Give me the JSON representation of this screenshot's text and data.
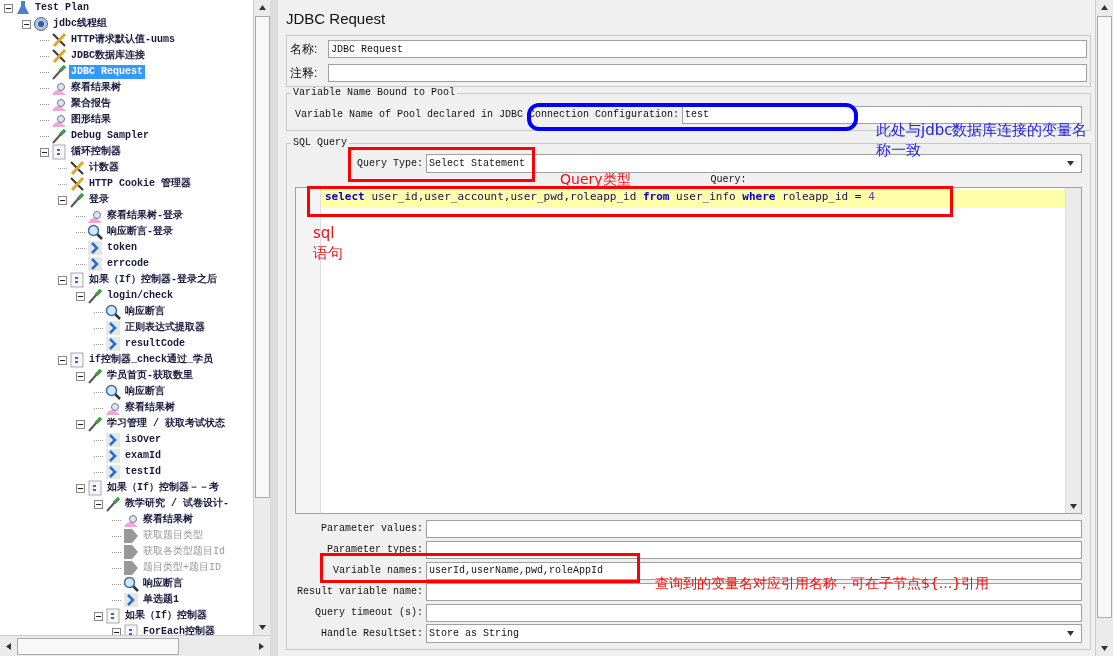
{
  "tree": [
    {
      "label": "Test Plan",
      "kind": "testplan",
      "expanded": true,
      "selected": false,
      "disabled": false,
      "children": [
        {
          "label": "jdbc线程组",
          "kind": "threadgroup",
          "expanded": true,
          "selected": false,
          "disabled": false,
          "children": [
            {
              "label": "HTTP请求默认值-uums",
              "kind": "config",
              "selected": false,
              "disabled": false
            },
            {
              "label": "JDBC数据库连接",
              "kind": "config",
              "selected": false,
              "disabled": false
            },
            {
              "label": "JDBC Request",
              "kind": "sampler",
              "selected": true,
              "disabled": false
            },
            {
              "label": "察看结果树",
              "kind": "listener",
              "selected": false,
              "disabled": false
            },
            {
              "label": "聚合报告",
              "kind": "listener",
              "selected": false,
              "disabled": false
            },
            {
              "label": "图形结果",
              "kind": "listener",
              "selected": false,
              "disabled": false
            },
            {
              "label": "Debug Sampler",
              "kind": "sampler",
              "selected": false,
              "disabled": false
            },
            {
              "label": "循环控制器",
              "kind": "controller",
              "expanded": true,
              "selected": false,
              "disabled": false,
              "children": [
                {
                  "label": "计数器",
                  "kind": "config",
                  "selected": false,
                  "disabled": false
                },
                {
                  "label": "HTTP Cookie 管理器",
                  "kind": "config",
                  "selected": false,
                  "disabled": false
                },
                {
                  "label": "登录",
                  "kind": "sampler",
                  "expanded": true,
                  "selected": false,
                  "disabled": false,
                  "children": [
                    {
                      "label": "察看结果树-登录",
                      "kind": "listener",
                      "selected": false,
                      "disabled": false
                    },
                    {
                      "label": "响应断言-登录",
                      "kind": "assertion",
                      "selected": false,
                      "disabled": false
                    },
                    {
                      "label": "token",
                      "kind": "extractor",
                      "selected": false,
                      "disabled": false
                    },
                    {
                      "label": "errcode",
                      "kind": "extractor",
                      "selected": false,
                      "disabled": false
                    }
                  ]
                },
                {
                  "label": "如果（If）控制器-登录之后",
                  "kind": "controller",
                  "expanded": true,
                  "selected": false,
                  "disabled": false,
                  "children": [
                    {
                      "label": "login/check",
                      "kind": "sampler",
                      "expanded": true,
                      "selected": false,
                      "disabled": false,
                      "children": [
                        {
                          "label": "响应断言",
                          "kind": "assertion",
                          "selected": false,
                          "disabled": false
                        },
                        {
                          "label": "正则表达式提取器",
                          "kind": "extractor",
                          "selected": false,
                          "disabled": false
                        },
                        {
                          "label": "resultCode",
                          "kind": "extractor",
                          "selected": false,
                          "disabled": false
                        }
                      ]
                    }
                  ]
                },
                {
                  "label": "if控制器_check通过_学员",
                  "kind": "controller",
                  "expanded": true,
                  "selected": false,
                  "disabled": false,
                  "children": [
                    {
                      "label": "学员首页-获取数里",
                      "kind": "sampler",
                      "expanded": true,
                      "selected": false,
                      "disabled": false,
                      "children": [
                        {
                          "label": "响应断言",
                          "kind": "assertion",
                          "selected": false,
                          "disabled": false
                        },
                        {
                          "label": "察看结果树",
                          "kind": "listener",
                          "selected": false,
                          "disabled": false
                        }
                      ]
                    },
                    {
                      "label": "学习管理 / 获取考试状态",
                      "kind": "sampler",
                      "expanded": true,
                      "selected": false,
                      "disabled": false,
                      "children": [
                        {
                          "label": "isOver",
                          "kind": "extractor",
                          "selected": false,
                          "disabled": false
                        },
                        {
                          "label": "examId",
                          "kind": "extractor",
                          "selected": false,
                          "disabled": false
                        },
                        {
                          "label": "testId",
                          "kind": "extractor",
                          "selected": false,
                          "disabled": false
                        }
                      ]
                    },
                    {
                      "label": "如果（If）控制器－－考",
                      "kind": "controller",
                      "expanded": true,
                      "selected": false,
                      "disabled": false,
                      "children": [
                        {
                          "label": "教学研究 / 试卷设计-",
                          "kind": "sampler",
                          "expanded": true,
                          "selected": false,
                          "disabled": false,
                          "children": [
                            {
                              "label": "察看结果树",
                              "kind": "listener",
                              "selected": false,
                              "disabled": false
                            },
                            {
                              "label": "获取题目类型",
                              "kind": "extractor",
                              "selected": false,
                              "disabled": true
                            },
                            {
                              "label": "获取各类型题目Id",
                              "kind": "extractor",
                              "selected": false,
                              "disabled": true
                            },
                            {
                              "label": "题目类型+题目ID",
                              "kind": "extractor",
                              "selected": false,
                              "disabled": true
                            },
                            {
                              "label": "响应断言",
                              "kind": "assertion",
                              "selected": false,
                              "disabled": false
                            },
                            {
                              "label": "单选题1",
                              "kind": "extractor",
                              "selected": false,
                              "disabled": false
                            }
                          ]
                        },
                        {
                          "label": "如果（If）控制器",
                          "kind": "controller",
                          "expanded": true,
                          "selected": false,
                          "disabled": false,
                          "children": [
                            {
                              "label": "ForEach控制器",
                              "kind": "controller",
                              "expanded": true,
                              "selected": false,
                              "disabled": false
                            }
                          ]
                        }
                      ]
                    }
                  ]
                }
              ]
            }
          ]
        }
      ]
    }
  ],
  "panel": {
    "title": "JDBC Request",
    "name_label": "名称:",
    "name_value": "JDBC Request",
    "comment_label": "注释:",
    "pool_group": "Variable Name Bound to Pool",
    "pool_label": "Variable Name of Pool declared in JDBC Connection Configuration:",
    "pool_value": "test",
    "sql_group": "SQL Query",
    "query_type_label": "Query Type:",
    "query_type_value": "Select Statement",
    "query_label": "Query:",
    "query_tokens": [
      {
        "text": "select",
        "kind": "keyword"
      },
      {
        "text": "user_id,user_account,user_pwd,roleapp_id",
        "kind": "plain"
      },
      {
        "text": "from",
        "kind": "keyword"
      },
      {
        "text": "user_info",
        "kind": "plain"
      },
      {
        "text": "where",
        "kind": "keyword"
      },
      {
        "text": "roleapp_id =",
        "kind": "plain"
      },
      {
        "text": "4",
        "kind": "number"
      }
    ],
    "fields": [
      {
        "label": "Parameter values:",
        "kind": "text"
      },
      {
        "label": "Parameter types:",
        "kind": "text"
      },
      {
        "label": "Variable names:",
        "kind": "text",
        "value": "userId,userName,pwd,roleAppId"
      },
      {
        "label": "Result variable name:",
        "kind": "text"
      },
      {
        "label": "Query timeout (s):",
        "kind": "text"
      },
      {
        "label": "Handle ResultSet:",
        "kind": "combo",
        "value": "Store as String"
      }
    ]
  },
  "annotations": [
    {
      "kind": "box",
      "color": "#0000ff"
    },
    {
      "kind": "note",
      "text": "此处与jdbc数据库连接的变量名称一致",
      "color": "#2222dd"
    },
    {
      "kind": "box",
      "color": "#ff0000"
    },
    {
      "kind": "note",
      "text": "Query类型",
      "color": "#ee1111"
    },
    {
      "kind": "box",
      "color": "#ff0000"
    },
    {
      "kind": "note",
      "text": "sql语句",
      "color": "#ee1111"
    },
    {
      "kind": "box",
      "color": "#ff0000"
    },
    {
      "kind": "note",
      "text": "查询到的变量名对应引用名称，可在子节点${...}引用",
      "color": "#ee1111"
    }
  ]
}
